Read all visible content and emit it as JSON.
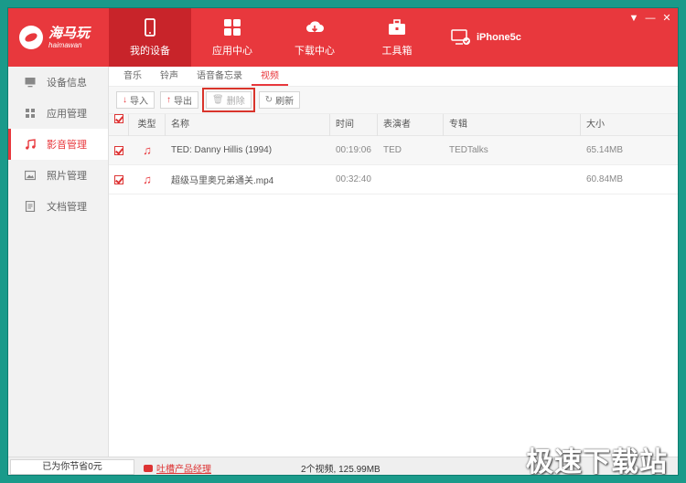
{
  "brand": {
    "name_cn": "海马玩",
    "name_en": "haimawan",
    "color": "#e8383d",
    "active_color": "#c8242a"
  },
  "nav": [
    {
      "label": "我的设备",
      "icon": "phone-icon"
    },
    {
      "label": "应用中心",
      "icon": "apps-grid-icon"
    },
    {
      "label": "下载中心",
      "icon": "cloud-download-icon"
    },
    {
      "label": "工具箱",
      "icon": "toolbox-icon"
    }
  ],
  "device": {
    "name": "iPhone5c",
    "icon": "connected-device-icon"
  },
  "window_controls": {
    "menu": "▼",
    "minimize": "—",
    "close": "✕"
  },
  "sidebar": [
    {
      "label": "设备信息",
      "icon": "monitor-icon"
    },
    {
      "label": "应用管理",
      "icon": "grid-icon"
    },
    {
      "label": "影音管理",
      "icon": "music-note-icon"
    },
    {
      "label": "照片管理",
      "icon": "picture-icon"
    },
    {
      "label": "文档管理",
      "icon": "document-icon"
    }
  ],
  "subtabs": [
    "音乐",
    "铃声",
    "语音备忘录",
    "视频"
  ],
  "toolbar": {
    "import": "导入",
    "export": "导出",
    "delete": "删除",
    "refresh": "刷新"
  },
  "table": {
    "headers": {
      "type": "类型",
      "name": "名称",
      "time": "时间",
      "artist": "表演者",
      "album": "专辑",
      "size": "大小"
    },
    "rows": [
      {
        "name": "TED: Danny Hillis (1994)",
        "time": "00:19:06",
        "artist": "TED",
        "album": "TEDTalks",
        "size": "65.14MB"
      },
      {
        "name": "超级马里奥兄弟通关.mp4",
        "time": "00:32:40",
        "artist": "",
        "album": "",
        "size": "60.84MB"
      }
    ]
  },
  "status": {
    "savings": "已为你节省0元",
    "feedback": "吐槽产品经理",
    "summary": "2个视频, 125.99MB",
    "watermark": "极速下载站"
  }
}
